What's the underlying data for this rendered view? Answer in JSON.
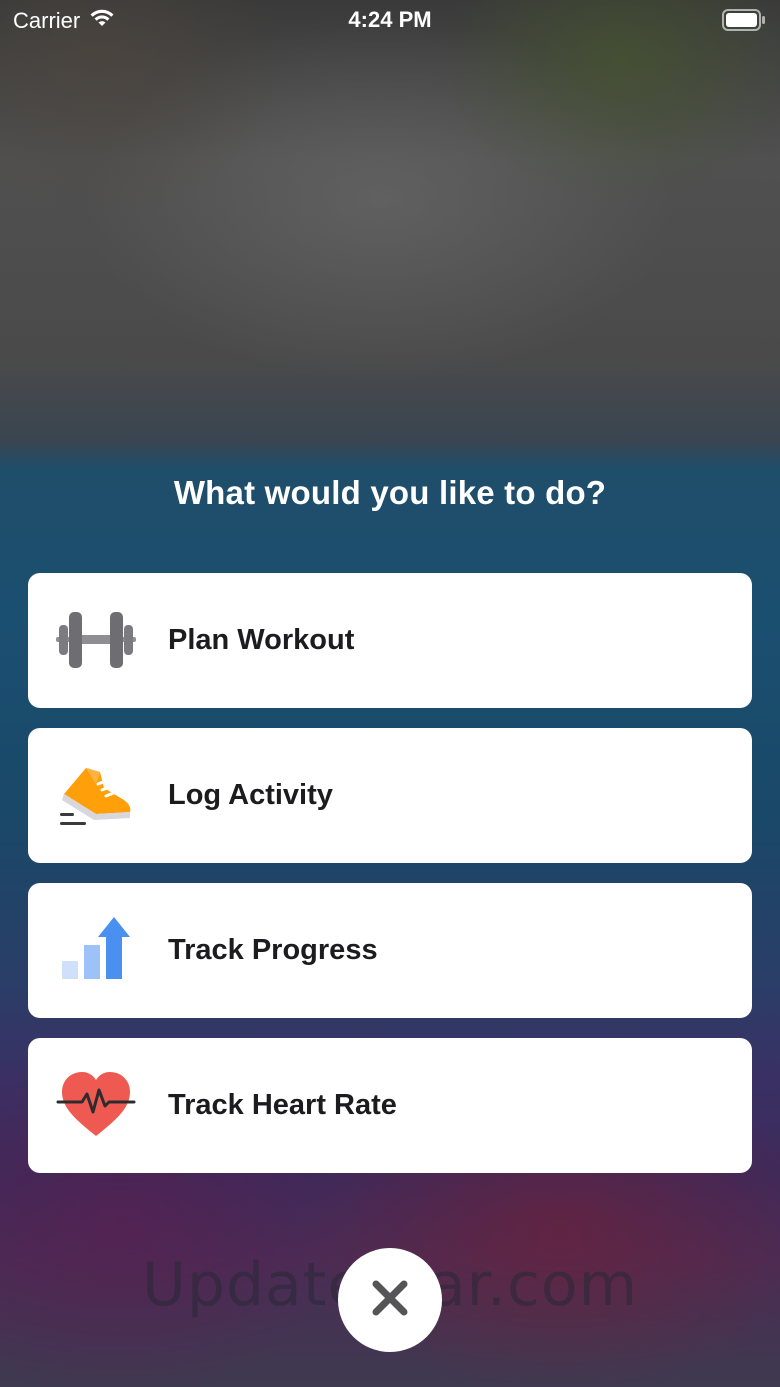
{
  "status_bar": {
    "carrier": "Carrier",
    "time": "4:24 PM",
    "wifi_icon": "wifi-icon",
    "battery_icon": "battery-icon"
  },
  "prompt": "What would you like to do?",
  "menu": {
    "items": [
      {
        "label": "Plan Workout",
        "icon": "dumbbell-icon"
      },
      {
        "label": "Log Activity",
        "icon": "running-shoe-icon"
      },
      {
        "label": "Track Progress",
        "icon": "bar-chart-arrow-icon"
      },
      {
        "label": "Track Heart Rate",
        "icon": "heart-rate-icon"
      }
    ]
  },
  "watermark": "UpdateStar.com",
  "close_button": {
    "icon": "close-icon"
  },
  "colors": {
    "card_background": "#ffffff",
    "label_text": "#1c1c1e",
    "shoe_orange": "#ff9f0a",
    "chart_blue": "#4a90f0",
    "heart_red": "#ee5a52"
  }
}
